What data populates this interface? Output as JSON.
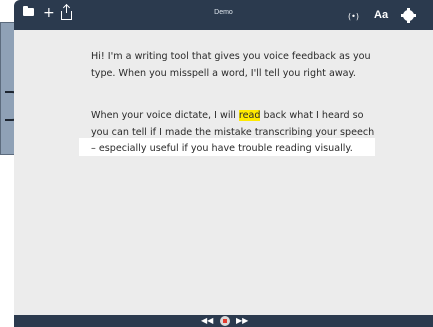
{
  "window": {
    "title": "Demo"
  },
  "toolbar": {
    "left_icons": [
      "folder-icon",
      "plus-icon",
      "share-icon"
    ],
    "plus_glyph": "+",
    "right_icons": [
      "broadcast-icon",
      "font-size-icon",
      "gear-icon"
    ],
    "broadcast_glyph": "(•)",
    "font_label": "Aa"
  },
  "document": {
    "paragraph1": "Hi! I'm a writing tool that gives you voice feedback as you type. When you misspell a word, I'll tell you right away.",
    "paragraph2_before": "When your voice dictate, I will ",
    "paragraph2_highlight": "read",
    "paragraph2_after": " back what I heard so you can tell if I made the mistake transcribing your speech – especially useful if you have trouble reading visually."
  },
  "playback": {
    "rewind_glyph": "◀◀",
    "forward_glyph": "▶▶",
    "icons": [
      "rewind-icon",
      "stop-icon",
      "fast-forward-icon"
    ]
  },
  "colors": {
    "frame": "#2b3a4e",
    "page": "#ececec",
    "highlight": "#ffea00",
    "stop": "#e23b2e"
  }
}
